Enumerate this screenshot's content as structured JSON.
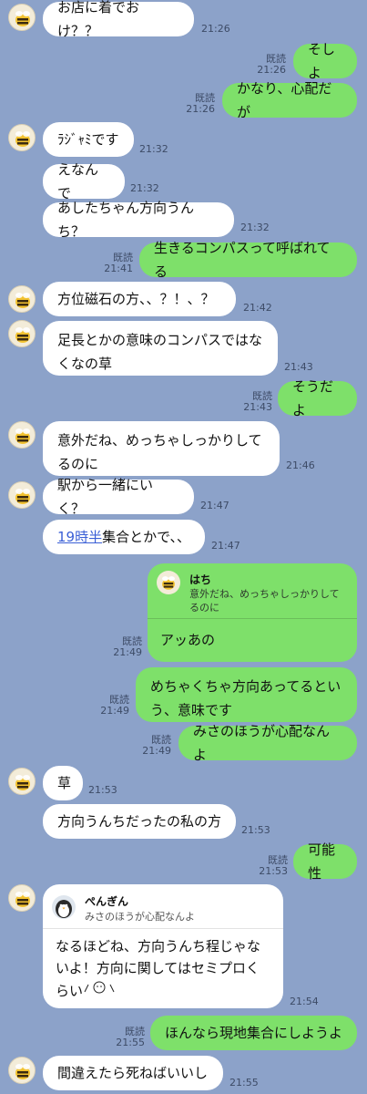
{
  "messages": [
    {
      "id": "m1",
      "text": "お店に着でおけ？？",
      "time": "21:26"
    },
    {
      "id": "m2",
      "text": "そしよ",
      "read": "既読",
      "time": "21:26"
    },
    {
      "id": "m3",
      "text": "かなり、心配だが",
      "read": "既読",
      "time": "21:26"
    },
    {
      "id": "m4",
      "text": "ﾗｼﾞｬﾐです",
      "time": "21:32"
    },
    {
      "id": "m5",
      "text": "えなんで",
      "time": "21:32"
    },
    {
      "id": "m6",
      "text": "あしたちゃん方向うんち？",
      "time": "21:32"
    },
    {
      "id": "m7",
      "text": "生きるコンパスって呼ばれてる",
      "read": "既読",
      "time": "21:41"
    },
    {
      "id": "m8",
      "text": "方位磁石の方、、？！、？",
      "time": "21:42"
    },
    {
      "id": "m9",
      "lines": [
        "足長とかの意味のコンパスではな",
        "くなの草"
      ],
      "time": "21:43"
    },
    {
      "id": "m10",
      "text": "そうだよ",
      "read": "既読",
      "time": "21:43"
    },
    {
      "id": "m11",
      "lines": [
        "意外だね、めっちゃしっかりして",
        "るのに"
      ],
      "time": "21:46"
    },
    {
      "id": "m12",
      "text": "駅から一緒にいく？",
      "time": "21:47"
    },
    {
      "id": "m13",
      "link": "19時半",
      "rest": "集合とかで、、",
      "time": "21:47"
    },
    {
      "id": "m14",
      "quote_name": "はち",
      "quote_lines": [
        "意外だね、めっちゃしっかりして",
        "るのに"
      ],
      "text": "アッあの",
      "read": "既読",
      "time": "21:49"
    },
    {
      "id": "m15",
      "lines": [
        "めちゃくちゃ方向あってるとい",
        "う、意味です"
      ],
      "read": "既読",
      "time": "21:49"
    },
    {
      "id": "m16",
      "text": "みさのほうが心配なんよ",
      "read": "既読",
      "time": "21:49"
    },
    {
      "id": "m17",
      "text": "草",
      "time": "21:53"
    },
    {
      "id": "m18",
      "text": "方向うんちだったの私の方",
      "time": "21:53"
    },
    {
      "id": "m19",
      "text": "可能性",
      "read": "既読",
      "time": "21:53"
    },
    {
      "id": "m20",
      "quote_name": "ぺんぎん",
      "quote_text": "みさのほうが心配なんよ",
      "lines": [
        "なるほどね、方向うんち程じゃな",
        "いよ！方向に関してはセミプロく",
        "らい"
      ],
      "time": "21:54"
    },
    {
      "id": "m21",
      "text": "ほんなら現地集合にしようよ",
      "read": "既読",
      "time": "21:55"
    },
    {
      "id": "m22",
      "text": "間違えたら死ねばいいし",
      "time": "21:55"
    }
  ],
  "colors": {
    "background": "#8ca2c9",
    "outgoing": "#7ee06a",
    "incoming": "#ffffff",
    "link": "#3a5fd6"
  },
  "icons": {
    "avatar": "bee-icon",
    "quote_avatar": "penguin-icon"
  }
}
